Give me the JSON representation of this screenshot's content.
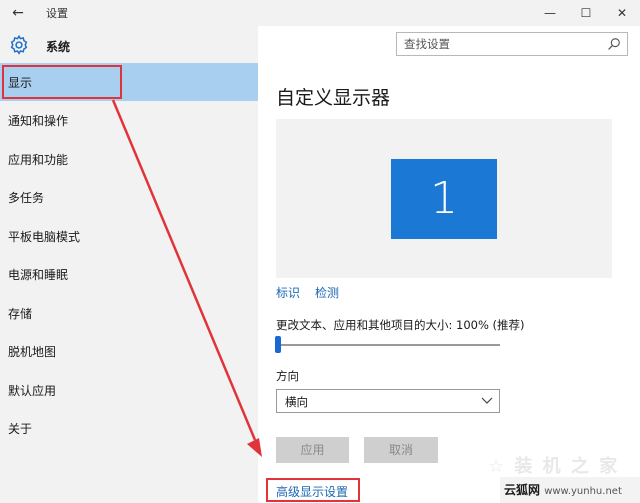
{
  "window": {
    "title": "设置",
    "back_icon": "←",
    "minimize_icon": "—",
    "maximize_icon": "☐",
    "close_icon": "✕"
  },
  "sidebar": {
    "header": "系统",
    "items": [
      {
        "label": "显示",
        "selected": true
      },
      {
        "label": "通知和操作"
      },
      {
        "label": "应用和功能"
      },
      {
        "label": "多任务"
      },
      {
        "label": "平板电脑模式"
      },
      {
        "label": "电源和睡眠"
      },
      {
        "label": "存储"
      },
      {
        "label": "脱机地图"
      },
      {
        "label": "默认应用"
      },
      {
        "label": "关于"
      }
    ]
  },
  "search": {
    "placeholder": "查找设置"
  },
  "main": {
    "title": "自定义显示器",
    "monitor_number": "1",
    "identify_link": "标识",
    "detect_link": "检测",
    "scale_label": "更改文本、应用和其他项目的大小: 100% (推荐)",
    "scale_value_percent": 100,
    "orientation_label": "方向",
    "orientation_value": "横向",
    "apply_button": "应用",
    "cancel_button": "取消",
    "advanced_link": "高级显示设置"
  },
  "watermark": {
    "logo_text": "☆ 装 机 之 家",
    "site_name": "云狐网",
    "site_url": "www.yunhu.net"
  },
  "colors": {
    "accent": "#1b78d4",
    "selected_bg": "#a9cff0",
    "annotation_red": "#e0343a",
    "link": "#1b67b3"
  }
}
